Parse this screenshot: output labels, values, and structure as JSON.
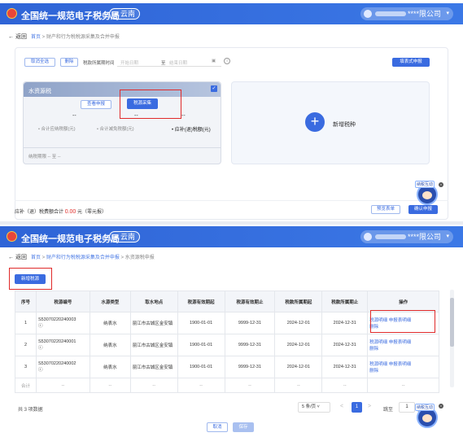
{
  "app": {
    "title": "全国统一规范电子税务局",
    "region": "云南",
    "company": "****限公司"
  },
  "top": {
    "breadcrumb": {
      "back": "返回",
      "home": "首页",
      "section": "财产和行为税税源采集及合并申报"
    },
    "toolbar": {
      "cancel_all": "取消全选",
      "delete": "删除",
      "period_label": "税款所属期时间",
      "start_placeholder": "开始日期",
      "to": "至",
      "end_placeholder": "结束日期",
      "submit": "填表式申报"
    },
    "tax_card": {
      "title": "水资源税",
      "view": "查看申报",
      "collect": "税源采集",
      "dash1": "--",
      "dash2": "--",
      "dash3": "--",
      "l1": "• 合计应纳税额(元)",
      "l2": "• 合计减免税额(元)",
      "l3": "• 应补(退)税额(元)",
      "period": "纳税期限 -- 至 --"
    },
    "add_card": {
      "label": "新增税种"
    },
    "footer": {
      "prefix": "应补（退）税费额合计",
      "amount": "0.00",
      "suffix": "元（零元报）",
      "preview": "预览表单",
      "confirm": "确认申报",
      "mascot_tag": "纳税互动"
    }
  },
  "bottom": {
    "breadcrumb": {
      "back": "返回",
      "home": "首页",
      "section": "财产和行为税税源采集及合并申报",
      "current": "水资源税申报"
    },
    "add_source": "新增税源",
    "table": {
      "headers": [
        "序号",
        "税源编号",
        "水源类型",
        "取水地点",
        "税源有效期起",
        "税源有效期止",
        "税款所属期起",
        "税款所属期止",
        "操作"
      ],
      "rows": [
        {
          "no": "1",
          "code": "S53070220240003",
          "type": "纳表水",
          "place": "丽江市古城区金安镇",
          "vs": "1900-01-01",
          "ve": "9999-12-31",
          "ps": "2024-12-01",
          "pe": "2024-12-31",
          "op1": "税源明细",
          "op2": "申报表明细",
          "op3": "删除"
        },
        {
          "no": "2",
          "code": "S53070220240001",
          "type": "纳表水",
          "place": "丽江市古城区金安镇",
          "vs": "1900-01-01",
          "ve": "9999-12-31",
          "ps": "2024-12-01",
          "pe": "2024-12-31",
          "op1": "税源明细",
          "op2": "申报表明细",
          "op3": "删除"
        },
        {
          "no": "3",
          "code": "S53070220240002",
          "type": "纳表水",
          "place": "丽江市古城区金安镇",
          "vs": "1900-01-01",
          "ve": "9999-12-31",
          "ps": "2024-12-01",
          "pe": "2024-12-31",
          "op1": "税源明细",
          "op2": "申报表明细",
          "op3": "删除"
        }
      ],
      "total_label": "合计",
      "total_dash": "--"
    },
    "pagination": {
      "total": "共 3 项数据",
      "page_size": "5 条/页",
      "prev": "<",
      "page": "1",
      "next": ">",
      "jump_label": "跳至",
      "jump_value": "1",
      "page_unit": "页"
    },
    "actions": {
      "cancel": "取消",
      "save": "保存"
    },
    "mascot_tag": "纳税互动"
  }
}
